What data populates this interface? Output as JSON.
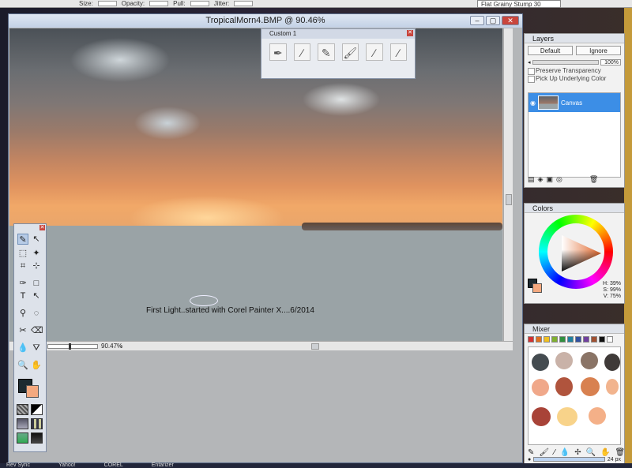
{
  "propbar": {
    "size_label": "Size:",
    "opacity_label": "Opacity:",
    "pull_label": "Pull:",
    "jitter_label": "Jitter:",
    "brush_name": "Flat Grainy Stump 30"
  },
  "window": {
    "title": "TropicalMorn4.BMP @ 90.46%",
    "zoom": "90.47%"
  },
  "canvas": {
    "caption": "First Light..started with Corel Painter X....6/2014"
  },
  "custom_palette": {
    "title": "Custom  1"
  },
  "layers": {
    "title": "Layers",
    "composite_method": "Default",
    "depth": "Ignore",
    "opacity": "100%",
    "preserve_transparency": "Preserve Transparency",
    "pick_up_underlying": "Pick Up Underlying Color",
    "layer_name": "Canvas"
  },
  "colors": {
    "title": "Colors",
    "h": "H: 39%",
    "s": "S: 99%",
    "v": "V: 75%",
    "main_color": "#1d2a30",
    "additional_color": "#f4a97f"
  },
  "mixer": {
    "title": "Mixer",
    "brush_size": "24 px"
  },
  "taskbar": {
    "items": [
      "Rev Sync",
      "Yahoo!",
      "COREL",
      "Entarizer"
    ]
  }
}
